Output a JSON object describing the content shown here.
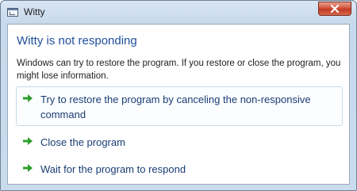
{
  "window": {
    "title": "Witty"
  },
  "dialog": {
    "heading": "Witty is not responding",
    "message": "Windows can try to restore the program. If you restore or close the program, you might lose information.",
    "options": [
      {
        "label": "Try to restore the program by canceling the non-responsive command",
        "icon": "green-arrow-icon"
      },
      {
        "label": "Close the program",
        "icon": "green-arrow-icon"
      },
      {
        "label": "Wait for the program to respond",
        "icon": "green-arrow-icon"
      }
    ]
  },
  "colors": {
    "heading": "#1f4e9c",
    "option_text": "#1a3d74",
    "arrow": "#2e9e2e",
    "close_button": "#c03a24"
  }
}
